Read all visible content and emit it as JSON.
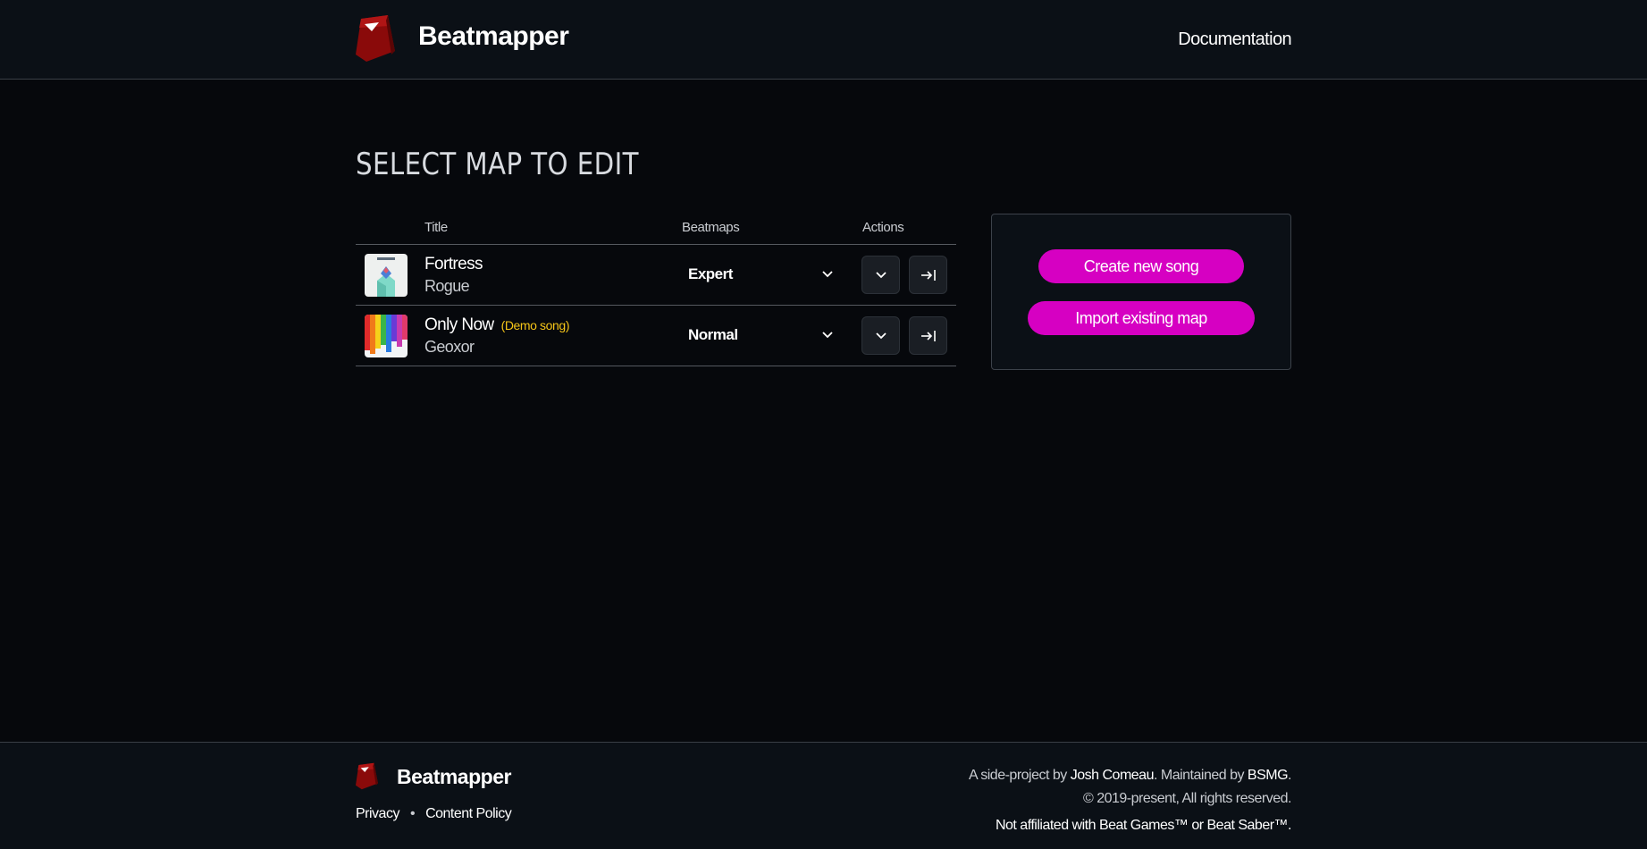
{
  "header": {
    "brand": "Beatmapper",
    "nav_documentation": "Documentation"
  },
  "main": {
    "page_title": "SELECT MAP TO EDIT",
    "table": {
      "columns": [
        "Title",
        "Beatmaps",
        "Actions"
      ],
      "rows": [
        {
          "title": "Fortress",
          "artist": "Rogue",
          "tag": "",
          "beatmap": "Expert"
        },
        {
          "title": "Only Now",
          "artist": "Geoxor",
          "tag": "(Demo song)",
          "beatmap": "Normal"
        }
      ]
    },
    "panel": {
      "create_label": "Create new song",
      "import_label": "Import existing map"
    }
  },
  "footer": {
    "brand": "Beatmapper",
    "privacy": "Privacy",
    "separator": "•",
    "content_policy": "Content Policy",
    "credit_prefix": "A side-project by ",
    "credit_author": "Josh Comeau",
    "credit_mid": ". Maintained by ",
    "credit_maintainer": "BSMG",
    "credit_suffix": ".",
    "copyright": "© 2019-present, All rights reserved.",
    "disclaimer": "Not affiliated with Beat Games™ or Beat Saber™."
  },
  "colors": {
    "accent": "#d600c2",
    "demo_tag": "#f5c518",
    "background": "#06080c",
    "surface": "#0b1016"
  },
  "icons": {
    "logo": "beatmapper-logo-icon",
    "dropdown": "chevron-down-icon",
    "expand": "chevron-down-icon",
    "open": "arrow-right-to-line-icon"
  }
}
